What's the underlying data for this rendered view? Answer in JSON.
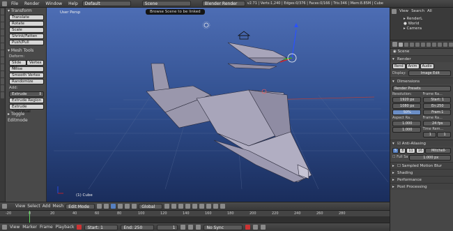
{
  "topbar": {
    "menus": [
      "File",
      "Render",
      "Window",
      "Help"
    ],
    "layout": "Default",
    "scene": "Scene",
    "engine": "Blender Render",
    "stats": "v2.71 | Verts:1,240 | Edges:0/376 | Faces:0/166 | Tris:346 | Mem:8.85M | Cube"
  },
  "tooltip": "Browse Scene to be linked",
  "toolbox": {
    "transform_title": "Transform",
    "transform": [
      "Translate",
      "Rotate",
      "Scale",
      "Shrink/Fatten",
      "Push/Pull"
    ],
    "mesh_tools_title": "Mesh Tools",
    "deform_label": "Deform:",
    "slide": [
      "Slide Ed",
      "Vertex"
    ],
    "deform": [
      "Noise",
      "Smooth Vertex",
      "Randomize"
    ],
    "add_label": "Add:",
    "extrude": "Extrude",
    "extrude_items": [
      "Extrude Region",
      "Extrude Individual"
    ],
    "toggle": "Toggle Editmode"
  },
  "viewport": {
    "label": "User Persp",
    "object": "(1) Cube"
  },
  "outliner": {
    "tabs": [
      "View",
      "Search",
      "All"
    ],
    "items": [
      "RenderL",
      "World",
      "Camera"
    ]
  },
  "properties": {
    "scene": "Scene",
    "render_title": "Render",
    "render_buttons": [
      "Rend",
      "Anim",
      "Audio"
    ],
    "display_label": "Display:",
    "display_value": "Image Edit",
    "dimensions_title": "Dimensions",
    "render_presets": "Render Presets",
    "resolution_label": "Resolution:",
    "res_x": "1920 px",
    "res_y": "1080 px",
    "res_pct": "50%",
    "frame_range_label": "Frame Ra...",
    "start": "Start: 1",
    "end": "En:250",
    "step": "Fram:1",
    "aspect_label": "Aspect Ra...",
    "aspect_x": "1.000",
    "aspect_y": "1.000",
    "fps_label": "Frame Ra...",
    "fps": "24 fps",
    "time_rem_label": "Time Rem...",
    "time_a": "1",
    "time_b": "1",
    "aa_title": "Anti-Aliasing",
    "aa_samples": [
      "5",
      "8",
      "11",
      "16"
    ],
    "aa_filter": "Mitchell-",
    "full_sample": "Full Sa",
    "filter_size": "1.000 px",
    "collapsed": [
      "Sampled Motion Blur",
      "Shading",
      "Performance",
      "Post Processing"
    ]
  },
  "header3d": {
    "menus": [
      "View",
      "Select",
      "Add",
      "Mesh"
    ],
    "mode": "Edit Mode",
    "orientation": "Global"
  },
  "timeline": {
    "ticks": [
      "-20",
      "0",
      "20",
      "40",
      "60",
      "80",
      "100",
      "120",
      "140",
      "160",
      "180",
      "200",
      "220",
      "240",
      "260",
      "280"
    ],
    "menus": [
      "View",
      "Marker",
      "Frame",
      "Playback"
    ],
    "start": "Start:",
    "start_val": "1",
    "end": "End:",
    "end_val": "250",
    "current": "1",
    "sync": "No Sync"
  }
}
